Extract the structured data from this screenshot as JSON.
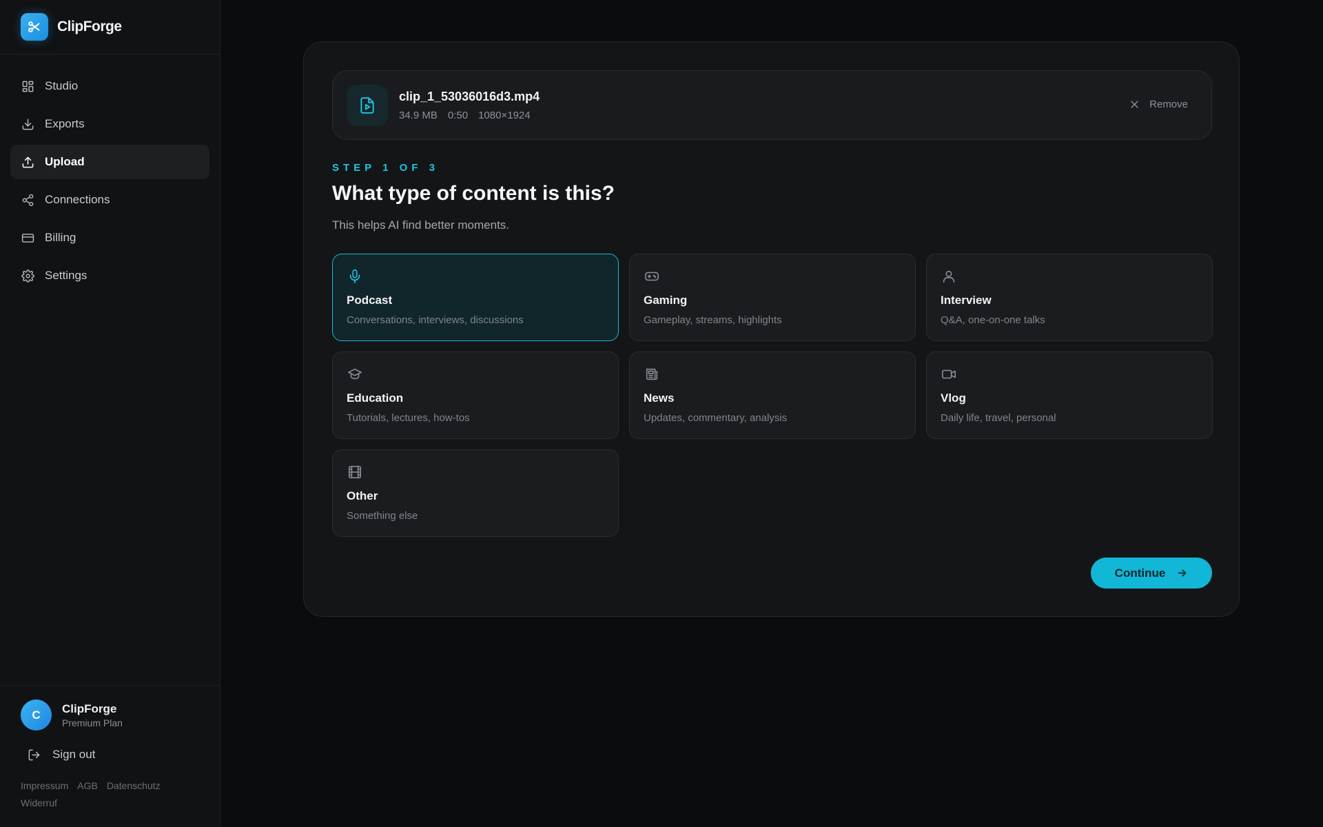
{
  "app": {
    "name": "ClipForge"
  },
  "sidebar": {
    "items": [
      {
        "label": "Studio",
        "icon": "grid-icon",
        "active": false
      },
      {
        "label": "Exports",
        "icon": "download-icon",
        "active": false
      },
      {
        "label": "Upload",
        "icon": "upload-icon",
        "active": true
      },
      {
        "label": "Connections",
        "icon": "share-icon",
        "active": false
      },
      {
        "label": "Billing",
        "icon": "credit-card-icon",
        "active": false
      },
      {
        "label": "Settings",
        "icon": "gear-icon",
        "active": false
      }
    ],
    "user": {
      "initial": "C",
      "name": "ClipForge",
      "plan": "Premium Plan"
    },
    "signout_label": "Sign out",
    "footer_links": [
      "Impressum",
      "AGB",
      "Datenschutz",
      "Widerruf"
    ]
  },
  "file": {
    "name": "clip_1_53036016d3.mp4",
    "size": "34.9 MB",
    "duration": "0:50",
    "resolution": "1080×1924",
    "remove_label": "Remove"
  },
  "wizard": {
    "step": "STEP 1 OF 3",
    "question": "What type of content is this?",
    "subtitle": "This helps AI find better moments.",
    "options": [
      {
        "title": "Podcast",
        "desc": "Conversations, interviews, discussions",
        "icon": "microphone-icon",
        "selected": true
      },
      {
        "title": "Gaming",
        "desc": "Gameplay, streams, highlights",
        "icon": "gamepad-icon",
        "selected": false
      },
      {
        "title": "Interview",
        "desc": "Q&A, one-on-one talks",
        "icon": "user-icon",
        "selected": false
      },
      {
        "title": "Education",
        "desc": "Tutorials, lectures, how-tos",
        "icon": "graduation-cap-icon",
        "selected": false
      },
      {
        "title": "News",
        "desc": "Updates, commentary, analysis",
        "icon": "newspaper-icon",
        "selected": false
      },
      {
        "title": "Vlog",
        "desc": "Daily life, travel, personal",
        "icon": "video-camera-icon",
        "selected": false
      },
      {
        "title": "Other",
        "desc": "Something else",
        "icon": "film-icon",
        "selected": false
      }
    ],
    "continue_label": "Continue"
  },
  "colors": {
    "accent": "#12b6d6",
    "background": "#0b0c0e",
    "sidebar": "#111214",
    "card": "#141517"
  }
}
